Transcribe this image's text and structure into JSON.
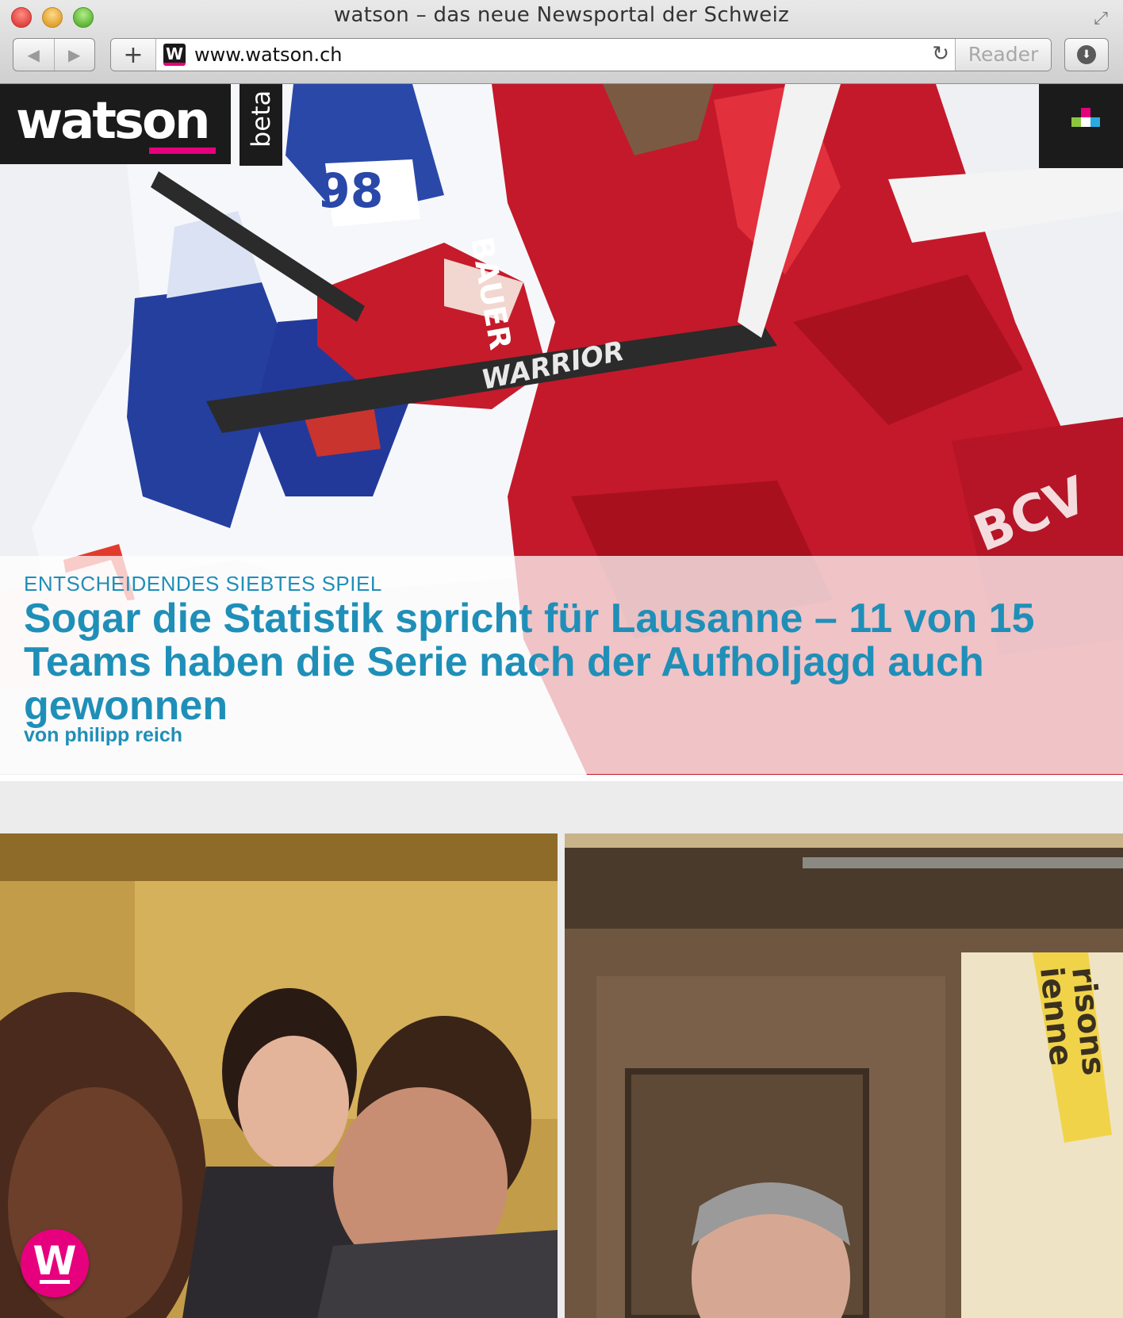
{
  "browser": {
    "window_title": "watson – das neue Newsportal der Schweiz",
    "url": "www.watson.ch",
    "reader_label": "Reader",
    "back_glyph": "◀",
    "forward_glyph": "▶",
    "add_glyph": "+",
    "reload_glyph": "↻",
    "fullscreen_glyph": "⤢",
    "favicon_letter": "W",
    "download_glyph": "⬇"
  },
  "site": {
    "logo": "watson",
    "beta": "beta",
    "brand_color": "#e6007e",
    "accent_color": "#1f8fb8",
    "menu_colors": [
      "#e6007e",
      "#8cc63f",
      "#29abe2",
      "#ffffff"
    ]
  },
  "hero": {
    "kicker": "ENTSCHEIDENDES SIEBTES SPIEL",
    "headline": "Sogar die Statistik spricht für Lausanne – 11 von 15 Teams haben die Serie nach der Aufholjagd auch gewonnen",
    "byline": "von philipp reich",
    "image_subject": "ice-hockey-players"
  },
  "tiles": [
    {
      "image_subject": "people-laughing"
    },
    {
      "image_subject": "man-in-wood-paneled-room"
    }
  ],
  "fab": {
    "letter": "W"
  }
}
